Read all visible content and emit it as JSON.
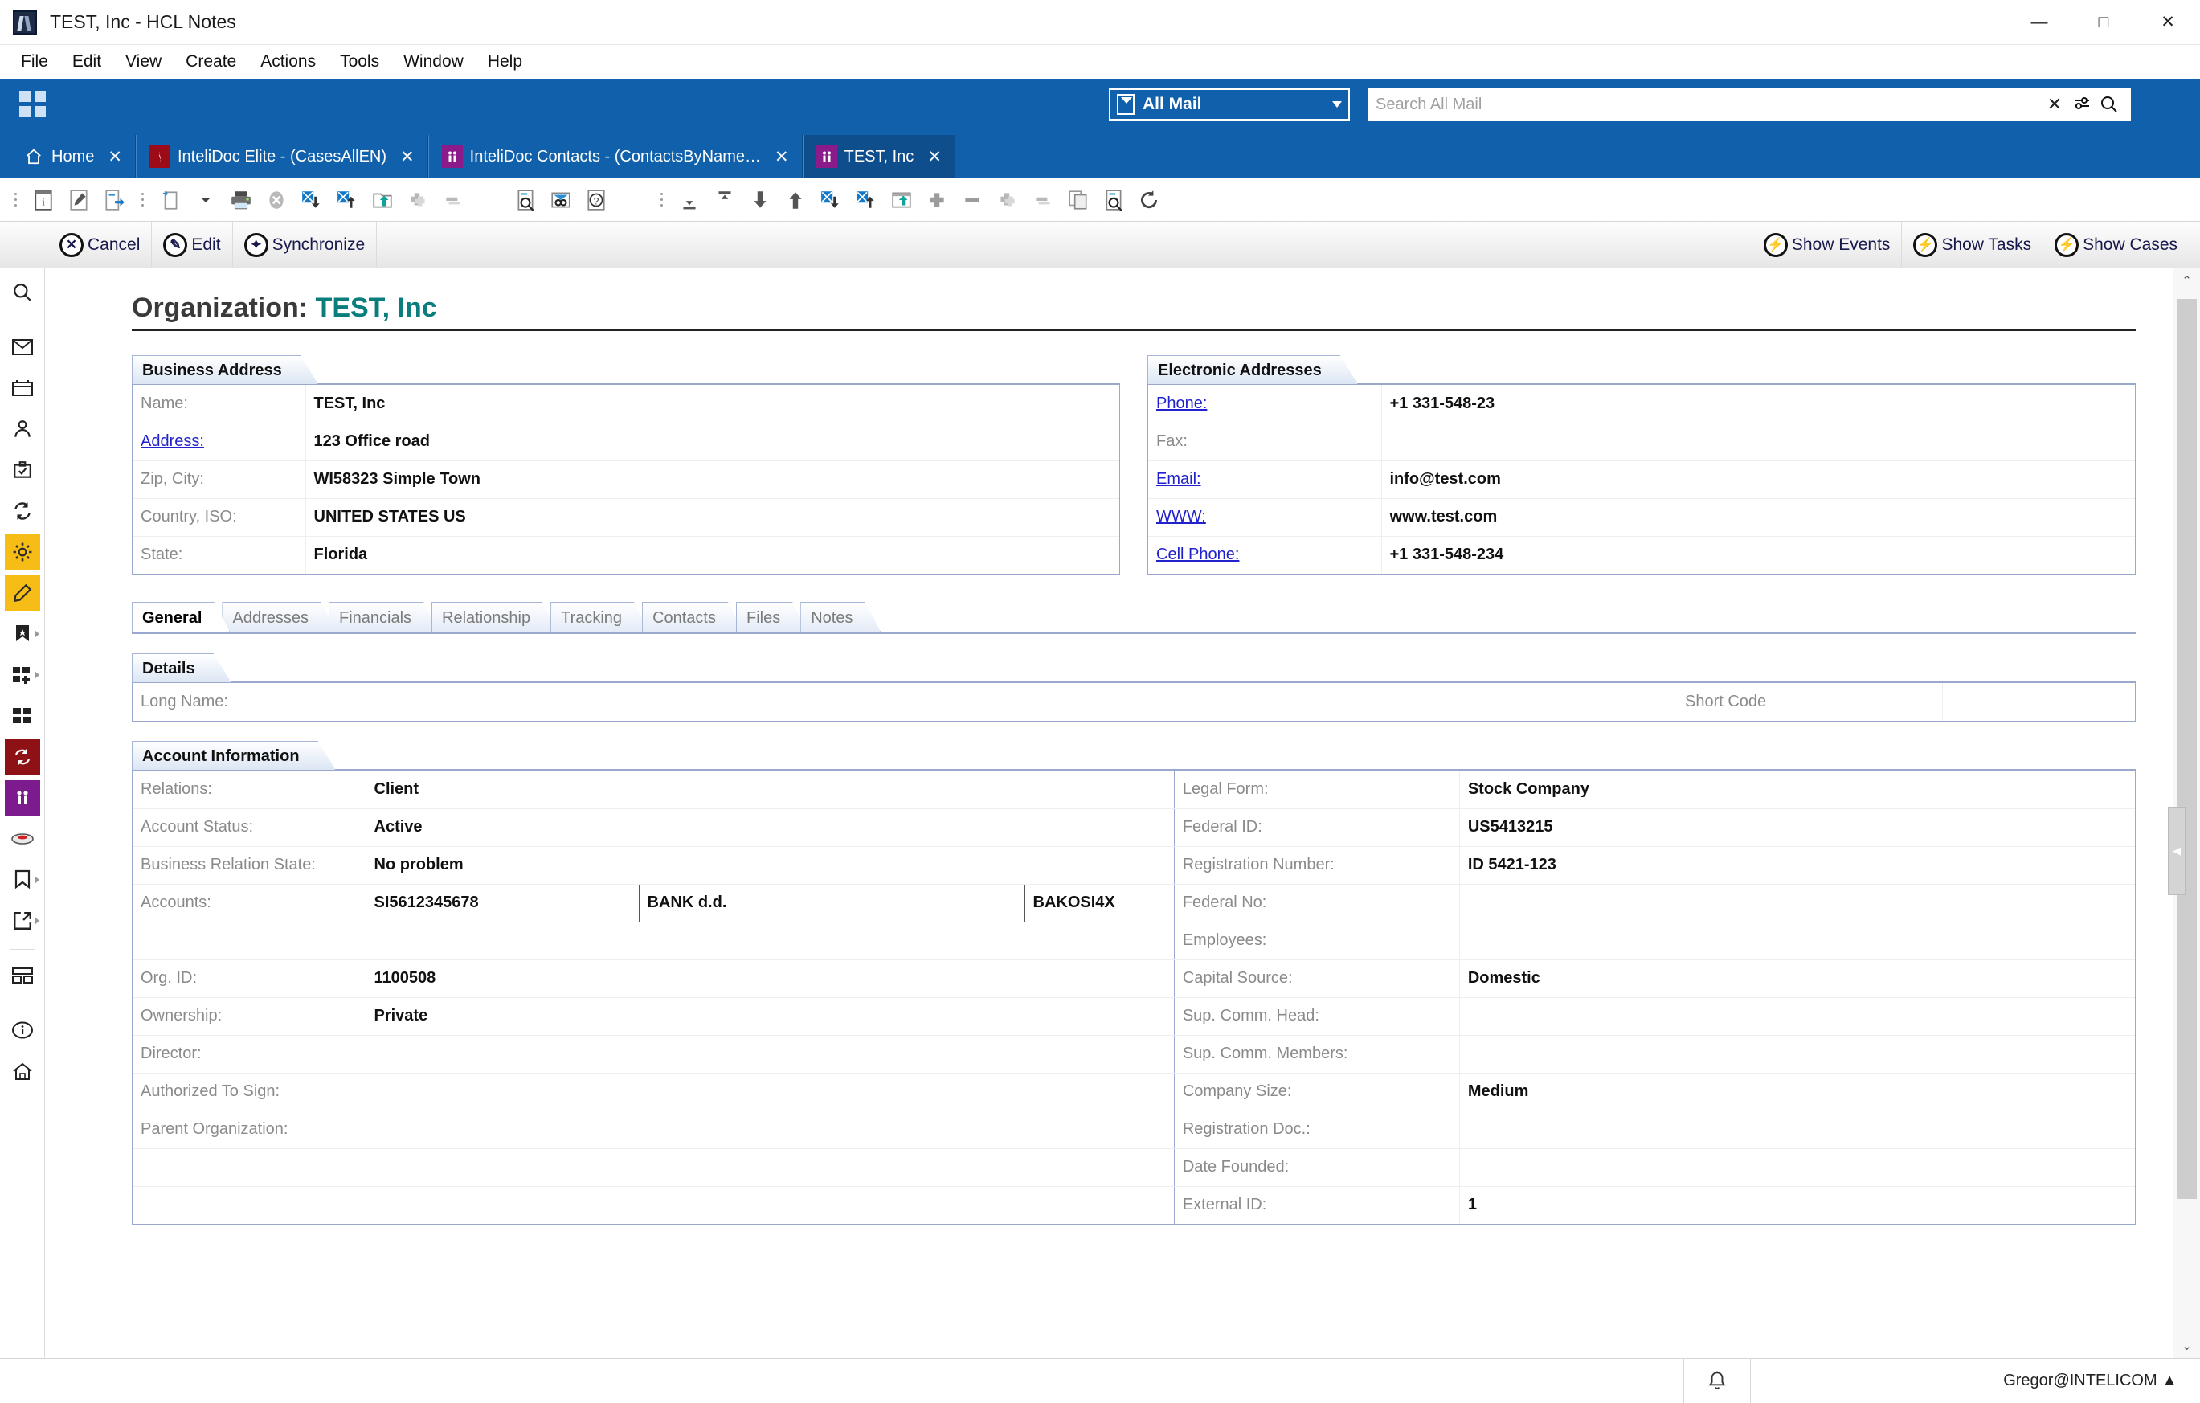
{
  "window": {
    "title": "TEST, Inc - HCL Notes",
    "app_icon": "hcl-notes-icon",
    "controls": {
      "minimize": "—",
      "maximize": "□",
      "close": "✕"
    }
  },
  "menubar": [
    "File",
    "Edit",
    "View",
    "Create",
    "Actions",
    "Tools",
    "Window",
    "Help"
  ],
  "bluebar": {
    "waffle_icon": "app-grid-icon",
    "mail_scope": {
      "label": "All Mail",
      "icon": "envelope-icon",
      "caret": "▾"
    },
    "search": {
      "placeholder": "Search All Mail",
      "value": "",
      "clear_icon": "✕",
      "filter_icon": "filter-icon",
      "search_icon": "search-icon"
    }
  },
  "tabs": [
    {
      "label": "Home",
      "icon": "home-icon",
      "active": false,
      "close": "✕"
    },
    {
      "label": "InteliDoc Elite - (CasesAllEN)",
      "icon": "cases-icon",
      "active": false,
      "close": "✕"
    },
    {
      "label": "InteliDoc Contacts - (ContactsByName…",
      "icon": "contacts-icon",
      "active": false,
      "close": "✕"
    },
    {
      "label": "TEST, Inc",
      "icon": "contacts-icon",
      "active": true,
      "close": "✕"
    }
  ],
  "toolbar": {
    "group1": [
      "properties-icon",
      "edit-document-icon",
      "forward-document-icon"
    ],
    "group2": [
      "new-document-icon",
      "new-dropdown-caret",
      "print-icon",
      "delete-icon",
      "move-down-icon",
      "move-up-icon",
      "folder-move-icon",
      "add-icon",
      "remove-icon"
    ],
    "group3": [
      "search-document-icon",
      "link-icon",
      "help-icon"
    ],
    "group4": [
      "collapse-all-icon",
      "expand-all-icon",
      "next-icon",
      "previous-icon",
      "mark-read-icon",
      "mark-unread-icon",
      "folder-icon",
      "plus-icon",
      "minus-icon",
      "add-layer-icon",
      "remove-layer-icon",
      "copy-icon",
      "find-icon",
      "refresh-icon"
    ]
  },
  "actionbar": {
    "left": [
      {
        "label": "Cancel",
        "icon": "cancel-icon",
        "glyph": "✕"
      },
      {
        "label": "Edit",
        "icon": "edit-icon",
        "glyph": "✎"
      },
      {
        "label": "Synchronize",
        "icon": "synchronize-icon",
        "glyph": "✦"
      }
    ],
    "right": [
      {
        "label": "Show Events",
        "icon": "lightning-icon",
        "glyph": "⚡"
      },
      {
        "label": "Show Tasks",
        "icon": "lightning-icon",
        "glyph": "⚡"
      },
      {
        "label": "Show Cases",
        "icon": "lightning-icon",
        "glyph": "⚡"
      }
    ]
  },
  "rail": [
    {
      "name": "search-icon",
      "style": "plain",
      "arrow": false
    },
    {
      "name": "mail-icon",
      "style": "plain",
      "arrow": false
    },
    {
      "name": "calendar-icon",
      "style": "plain",
      "arrow": false
    },
    {
      "name": "contacts-icon",
      "style": "plain",
      "arrow": false
    },
    {
      "name": "tasks-icon",
      "style": "plain",
      "arrow": false
    },
    {
      "name": "replication-icon",
      "style": "plain",
      "arrow": false
    },
    {
      "name": "settings-gear-icon",
      "style": "yellow",
      "arrow": false
    },
    {
      "name": "pencil-icon",
      "style": "yellow",
      "arrow": false
    },
    {
      "name": "bookmark-star-icon",
      "style": "plain",
      "arrow": true
    },
    {
      "name": "add-application-icon",
      "style": "plain",
      "arrow": true
    },
    {
      "name": "applications-grid-icon",
      "style": "plain",
      "arrow": false
    },
    {
      "name": "intelidoc-elite-icon",
      "style": "darkred",
      "arrow": false
    },
    {
      "name": "intelidoc-contacts-icon",
      "style": "purple",
      "arrow": false
    },
    {
      "name": "database-icon",
      "style": "plain",
      "arrow": false
    },
    {
      "name": "bookmark-icon",
      "style": "plain",
      "arrow": true
    },
    {
      "name": "open-external-icon",
      "style": "plain",
      "arrow": true
    },
    {
      "name": "layout-icon",
      "style": "plain",
      "arrow": false
    },
    {
      "name": "info-icon",
      "style": "plain",
      "arrow": false
    },
    {
      "name": "home-icon",
      "style": "plain",
      "arrow": false
    }
  ],
  "document": {
    "title_prefix": "Organization:",
    "title_value": "TEST, Inc",
    "business_address": {
      "heading": "Business Address",
      "rows": [
        {
          "label": "Name:",
          "link": false,
          "value": "TEST, Inc"
        },
        {
          "label": "Address:",
          "link": true,
          "value": "123 Office road"
        },
        {
          "label": "Zip, City:",
          "link": false,
          "value": "WI58323 Simple Town"
        },
        {
          "label": "Country, ISO:",
          "link": false,
          "value": "UNITED STATES US"
        },
        {
          "label": "State:",
          "link": false,
          "value": "Florida"
        }
      ]
    },
    "electronic_addresses": {
      "heading": "Electronic Addresses",
      "rows": [
        {
          "label": "Phone:",
          "link": true,
          "value": "+1 331-548-23"
        },
        {
          "label": "Fax:",
          "link": false,
          "value": ""
        },
        {
          "label": "Email:",
          "link": true,
          "value": "info@test.com"
        },
        {
          "label": "WWW:",
          "link": true,
          "value": "www.test.com"
        },
        {
          "label": "Cell Phone:",
          "link": true,
          "value": "+1 331-548-234"
        }
      ]
    },
    "doc_tabs": [
      {
        "label": "General",
        "active": true
      },
      {
        "label": "Addresses",
        "active": false
      },
      {
        "label": "Financials",
        "active": false
      },
      {
        "label": "Relationship",
        "active": false
      },
      {
        "label": "Tracking",
        "active": false
      },
      {
        "label": "Contacts",
        "active": false
      },
      {
        "label": "Files",
        "active": false
      },
      {
        "label": "Notes",
        "active": false
      }
    ],
    "details": {
      "heading": "Details",
      "long_name_label": "Long Name:",
      "long_name_value": "",
      "short_code_label": "Short Code",
      "short_code_value": ""
    },
    "account_information": {
      "heading": "Account Information",
      "left_rows": [
        {
          "label": "Relations:",
          "value": "Client"
        },
        {
          "label": "Account Status:",
          "value": "Active"
        },
        {
          "label": "Business Relation State:",
          "value": "No problem"
        },
        {
          "label": "Accounts:",
          "value": "SI5612345678",
          "value2": "BANK d.d.",
          "value3": "BAKOSI4X"
        },
        {
          "label": "",
          "value": ""
        },
        {
          "label": "Org. ID:",
          "value": "1100508"
        },
        {
          "label": "Ownership:",
          "value": "Private"
        },
        {
          "label": "Director:",
          "value": ""
        },
        {
          "label": "Authorized To Sign:",
          "value": ""
        },
        {
          "label": "Parent Organization:",
          "value": ""
        },
        {
          "label": "",
          "value": ""
        },
        {
          "label": "",
          "value": ""
        }
      ],
      "right_rows": [
        {
          "label": "Legal Form:",
          "value": "Stock Company"
        },
        {
          "label": "Federal ID:",
          "value": "US5413215"
        },
        {
          "label": "Registration Number:",
          "value": "ID 5421-123"
        },
        {
          "label": "Federal No:",
          "value": ""
        },
        {
          "label": "Employees:",
          "value": ""
        },
        {
          "label": "Capital Source:",
          "value": "Domestic"
        },
        {
          "label": "Sup. Comm. Head:",
          "value": ""
        },
        {
          "label": "Sup. Comm. Members:",
          "value": ""
        },
        {
          "label": "Company Size:",
          "value": "Medium"
        },
        {
          "label": "Registration Doc.:",
          "value": ""
        },
        {
          "label": "Date Founded:",
          "value": ""
        },
        {
          "label": "External ID:",
          "value": "1"
        }
      ]
    }
  },
  "scrollbar": {
    "up": "⌃",
    "down": "⌄",
    "handle": "◀"
  },
  "statusbar": {
    "bell_icon": "notification-bell-icon",
    "user": "Gregor@INTELICOM ▲"
  },
  "colors": {
    "accent_blue": "#1060ab",
    "title_teal": "#0a7d7d",
    "panel_border": "#9aa8cf",
    "link_blue": "#2222cc",
    "yellow": "#f5bd15",
    "dark_red": "#8e1116",
    "purple": "#7b1b8e"
  }
}
